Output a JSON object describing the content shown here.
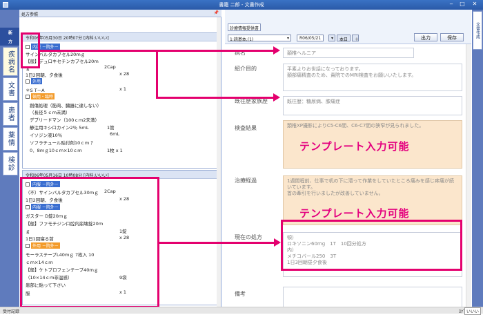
{
  "window": {
    "title": "書籍 二郎 - 文書作成"
  },
  "left_tabs": [
    "新 方",
    "疾病名",
    "文書",
    "患者",
    "薬情",
    "検診"
  ],
  "left_panel": {
    "title": "処方参照",
    "pin": "📌",
    "block1": {
      "header": "令和06年05月30日 20時07分 [内科:いいい]",
      "lines": [
        "内服 －院外－",
        "サインバルタカプセル20ｍｇ",
        "【般】デュロキセチンカプセル20ｍ",
        "ｇ",
        "1日2回朝、夕食後",
        "外用",
        "＊S T－A",
        "頓用・臨時",
        "創傷処理（筋肉、臓器に達しない）",
        "（長径５ｃｍ未満）",
        "デブリードマン（100ｃｍ2未満）",
        "静注用キシロカイン2％ 5ｍL",
        "イソジン液10％",
        "ソフラチュール貼付剤10ｃｍ ｱ",
        "0．8ｍｇ10ｃｍ×10ｃｍ"
      ],
      "qty": [
        "2Cap",
        "x 28",
        "x 1",
        "1管",
        "6mL",
        "1枚 x 1"
      ]
    },
    "block2": {
      "header": "令和06年05月16日 10時08分 [内科:いいい]",
      "lines": [
        "内服 －院外－",
        "（不）サインバルタカプセル30ｍｇ",
        "1日2回朝、夕食後",
        "内服 －院外－",
        "ガスター D錠20ｍｇ",
        "【般】ファモチジン口腔内崩壊錠20ｍ",
        "ｇ",
        "1日1回寝る前",
        "外用 －院外－",
        "モーラステープL40ｍｇ 7枚入 10",
        "ｃｍ×14ｃｍ",
        "【般】ケトプロフェンテープ40ｍｇ",
        "（10×14ｃｍ非温感）",
        "患部に貼って下さい",
        "服"
      ],
      "qty": [
        "2Cap",
        "x 28",
        "1錠",
        "x 28",
        "9袋",
        "x 1"
      ]
    }
  },
  "toolbar": {
    "tab": "診療情報提供書",
    "select": "1:読基本,(1)",
    "date": "R06/05/21",
    "cal": "▾",
    "today": "本日",
    "plus": "＋",
    "print": "出力",
    "save": "保存"
  },
  "form": {
    "labels": {
      "disease": "病名",
      "purpose": "紹介目的",
      "history": "既往歴家族歴",
      "exam": "検査結果",
      "course": "治療経過",
      "rx": "現在の処方",
      "remarks": "備考"
    },
    "disease": "頚椎ヘルニア",
    "purpose": "平素よりお世話になっております。\n頚部痛精査のため、貴院でのMRI検査をお願いいたします。",
    "history": "既往歴：糖尿病、膝痛症",
    "exam": "頚椎XP撮影によりC5-C6間、C6-C7間の狭窄が見られました。",
    "course": "1週間程前、仕事で机の下に潜って作業をしていたところ痛みを感じ疼痛が続いています。\n首の牽引を行いましたが改善していません。",
    "rx": "頓）\nロキソニン60mg　1T　10回分処方\n内）\nメチコバール250　3T\n1日3回朝昼夕食後",
    "remarks": "",
    "template_label": "テンプレート入力可能"
  },
  "status": {
    "left": "受付記録",
    "user": "ﾛｸﾞｲﾝ",
    "user_btn": "いいい"
  }
}
